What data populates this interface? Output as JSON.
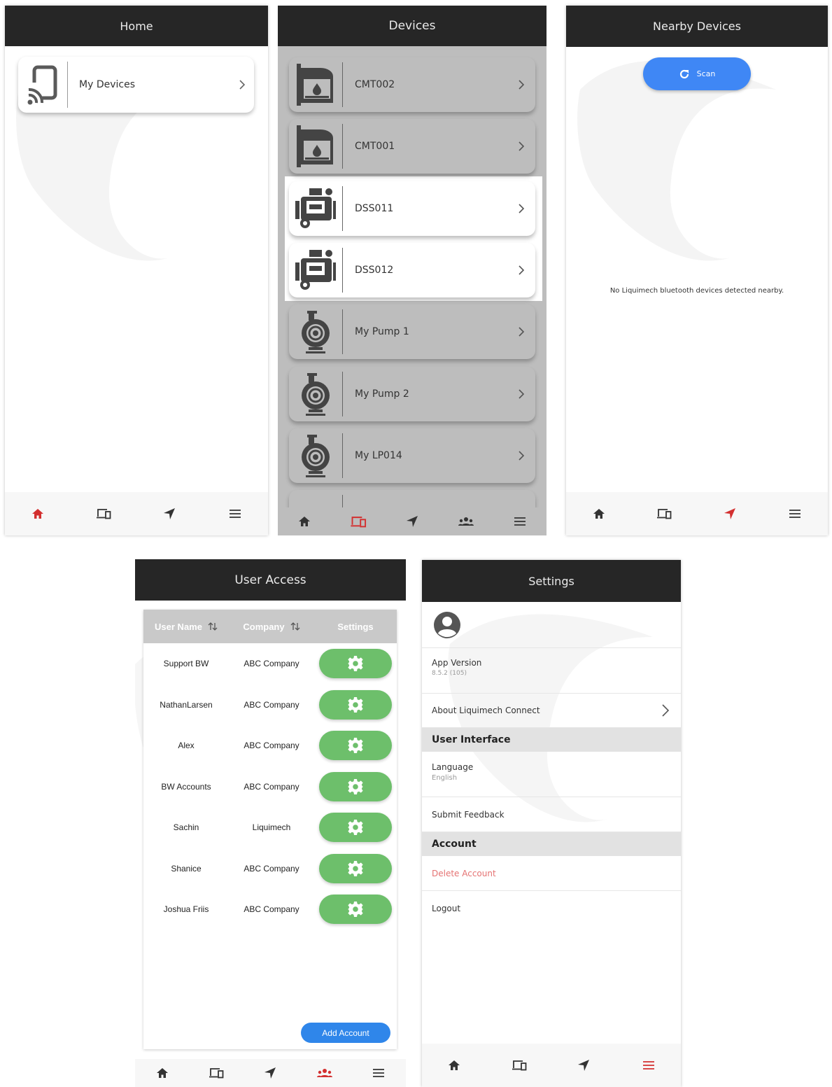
{
  "colors": {
    "appbar": "#262626",
    "nav_active": "#d32f2f",
    "accent_blue": "#3f87f5",
    "gear_green": "#6dbf6b",
    "danger": "#e57373"
  },
  "home": {
    "title": "Home",
    "card": {
      "label": "My Devices",
      "icon": "cast-device-icon"
    },
    "active_tab": "home"
  },
  "devices": {
    "title": "Devices",
    "items": [
      {
        "label": "CMT002",
        "icon": "tank-icon",
        "highlighted": false
      },
      {
        "label": "CMT001",
        "icon": "tank-icon",
        "highlighted": false
      },
      {
        "label": "DSS011",
        "icon": "generator-icon",
        "highlighted": true
      },
      {
        "label": "DSS012",
        "icon": "generator-icon",
        "highlighted": true
      },
      {
        "label": "My Pump 1",
        "icon": "pump-icon",
        "highlighted": false
      },
      {
        "label": "My Pump 2",
        "icon": "pump-icon",
        "highlighted": false
      },
      {
        "label": "My LP014",
        "icon": "pump-icon",
        "highlighted": false
      }
    ],
    "active_tab": "devices"
  },
  "nearby": {
    "title": "Nearby Devices",
    "scan_label": "Scan",
    "empty_message": "No Liquimech bluetooth devices detected nearby.",
    "active_tab": "nearby"
  },
  "user_access": {
    "title": "User Access",
    "columns": [
      "User Name",
      "Company",
      "Settings"
    ],
    "rows": [
      {
        "user": "Support BW",
        "company": "ABC Company"
      },
      {
        "user": "NathanLarsen",
        "company": "ABC Company"
      },
      {
        "user": "Alex",
        "company": "ABC Company"
      },
      {
        "user": "BW Accounts",
        "company": "ABC Company"
      },
      {
        "user": "Sachin",
        "company": "Liquimech"
      },
      {
        "user": "Shanice",
        "company": "ABC Company"
      },
      {
        "user": "Joshua Friis",
        "company": "ABC Company"
      }
    ],
    "add_account_label": "Add Account",
    "active_tab": "users"
  },
  "settings": {
    "title": "Settings",
    "app_version_label": "App Version",
    "app_version_value": "8.5.2 (105)",
    "about_label": "About Liquimech Connect",
    "section_ui": "User Interface",
    "language_label": "Language",
    "language_value": "English",
    "feedback_label": "Submit Feedback",
    "section_account": "Account",
    "delete_label": "Delete Account",
    "logout_label": "Logout",
    "active_tab": "menu"
  }
}
